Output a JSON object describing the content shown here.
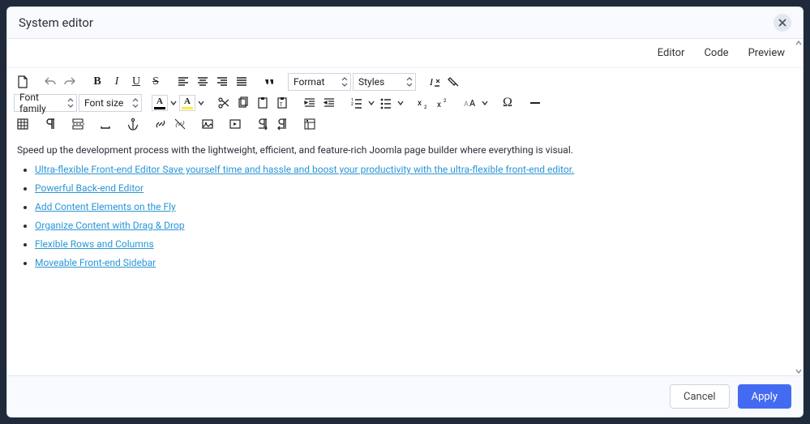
{
  "modal": {
    "title": "System editor"
  },
  "tabs": {
    "editor": "Editor",
    "code": "Code",
    "preview": "Preview"
  },
  "toolbar": {
    "format_label": "Format",
    "styles_label": "Styles",
    "font_family_label": "Font family",
    "font_size_label": "Font size",
    "bold": "B",
    "italic": "I",
    "underline": "U",
    "strike": "S",
    "textcolor_letter": "A",
    "bgcolor_letter": "A",
    "charmap_glyph": "Ω"
  },
  "content": {
    "lead": "Speed up the development process with the lightweight, efficient, and feature-rich Joomla page builder where everything is visual.",
    "links": [
      "Ultra-flexible Front-end Editor Save yourself time and hassle and boost your productivity with the ultra-flexible front-end editor.",
      "Powerful Back-end Editor",
      "Add Content Elements on the Fly",
      "Organize Content with Drag & Drop",
      "Flexible Rows and Columns",
      "Moveable Front-end Sidebar"
    ]
  },
  "footer": {
    "cancel": "Cancel",
    "apply": "Apply"
  },
  "colors": {
    "text_underline": "#000000",
    "bg_underline": "#ffeb3b",
    "link": "#2a96d6",
    "apply_bg": "#436bf2"
  }
}
